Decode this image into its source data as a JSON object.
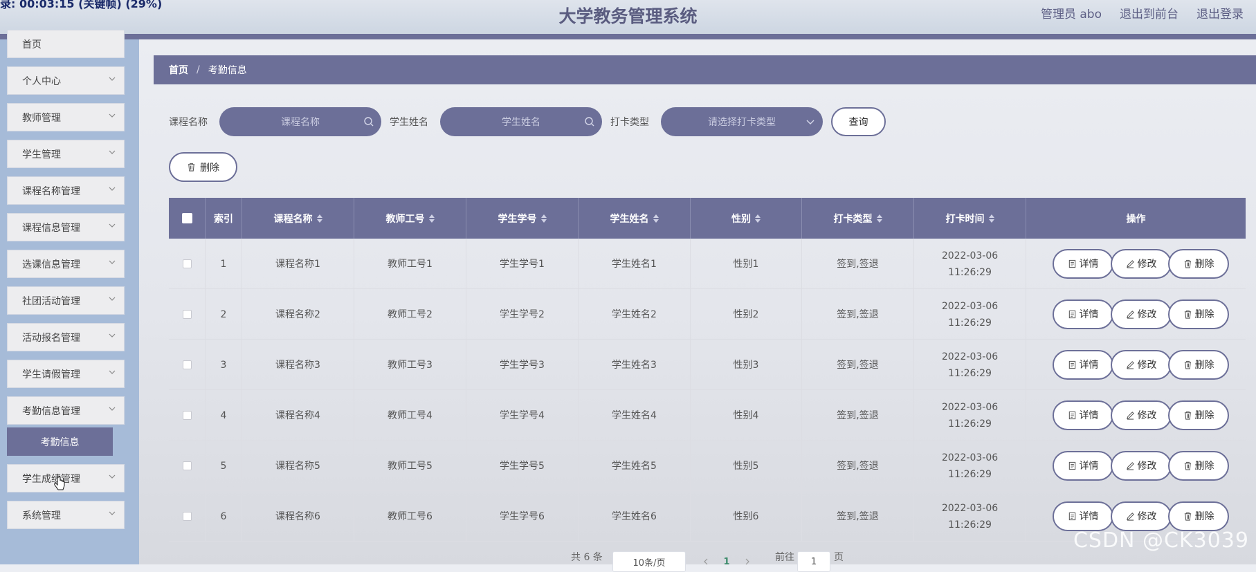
{
  "header": {
    "ticker": "录: 00:03:15 (关键帧) (29%)",
    "title": "大学教务管理系统",
    "admin": "管理员 abo",
    "back_front": "退出到前台",
    "logout": "退出登录"
  },
  "sidebar": {
    "items": [
      {
        "label": "首页"
      },
      {
        "label": "个人中心"
      },
      {
        "label": "教师管理"
      },
      {
        "label": "学生管理"
      },
      {
        "label": "课程名称管理"
      },
      {
        "label": "课程信息管理"
      },
      {
        "label": "选课信息管理"
      },
      {
        "label": "社团活动管理"
      },
      {
        "label": "活动报名管理"
      },
      {
        "label": "学生请假管理"
      },
      {
        "label": "考勤信息管理"
      },
      {
        "label": "学生成绩管理"
      },
      {
        "label": "系统管理"
      }
    ],
    "active_sub": "考勤信息"
  },
  "breadcrumb": {
    "home": "首页",
    "sep": "/",
    "current": "考勤信息"
  },
  "search": {
    "course_label": "课程名称",
    "course_placeholder": "课程名称",
    "student_label": "学生姓名",
    "student_placeholder": "学生姓名",
    "type_label": "打卡类型",
    "type_placeholder": "请选择打卡类型",
    "query": "查询",
    "delete": "删除"
  },
  "table": {
    "headers": {
      "index": "索引",
      "course": "课程名称",
      "teacher": "教师工号",
      "student_no": "学生学号",
      "student_name": "学生姓名",
      "gender": "性别",
      "type": "打卡类型",
      "time": "打卡时间",
      "ops": "操作"
    },
    "rows": [
      {
        "index": "1",
        "course": "课程名称1",
        "teacher": "教师工号1",
        "student_no": "学生学号1",
        "student_name": "学生姓名1",
        "gender": "性别1",
        "type": "签到,签退",
        "time": "2022-03-06 11:26:29"
      },
      {
        "index": "2",
        "course": "课程名称2",
        "teacher": "教师工号2",
        "student_no": "学生学号2",
        "student_name": "学生姓名2",
        "gender": "性别2",
        "type": "签到,签退",
        "time": "2022-03-06 11:26:29"
      },
      {
        "index": "3",
        "course": "课程名称3",
        "teacher": "教师工号3",
        "student_no": "学生学号3",
        "student_name": "学生姓名3",
        "gender": "性别3",
        "type": "签到,签退",
        "time": "2022-03-06 11:26:29"
      },
      {
        "index": "4",
        "course": "课程名称4",
        "teacher": "教师工号4",
        "student_no": "学生学号4",
        "student_name": "学生姓名4",
        "gender": "性别4",
        "type": "签到,签退",
        "time": "2022-03-06 11:26:29"
      },
      {
        "index": "5",
        "course": "课程名称5",
        "teacher": "教师工号5",
        "student_no": "学生学号5",
        "student_name": "学生姓名5",
        "gender": "性别5",
        "type": "签到,签退",
        "time": "2022-03-06 11:26:29"
      },
      {
        "index": "6",
        "course": "课程名称6",
        "teacher": "教师工号6",
        "student_no": "学生学号6",
        "student_name": "学生姓名6",
        "gender": "性别6",
        "type": "签到,签退",
        "time": "2022-03-06 11:26:29"
      }
    ],
    "actions": {
      "detail": "详情",
      "edit": "修改",
      "delete": "删除"
    }
  },
  "pagination": {
    "total": "共 6 条",
    "page_size": "10条/页",
    "current_page": "1",
    "goto": "前往",
    "goto_value": "1",
    "page_unit": "页"
  },
  "watermark": "CSDN @CK3039",
  "colors": {
    "accent": "#6c6f98",
    "sidebar": "#a6bbd8"
  }
}
